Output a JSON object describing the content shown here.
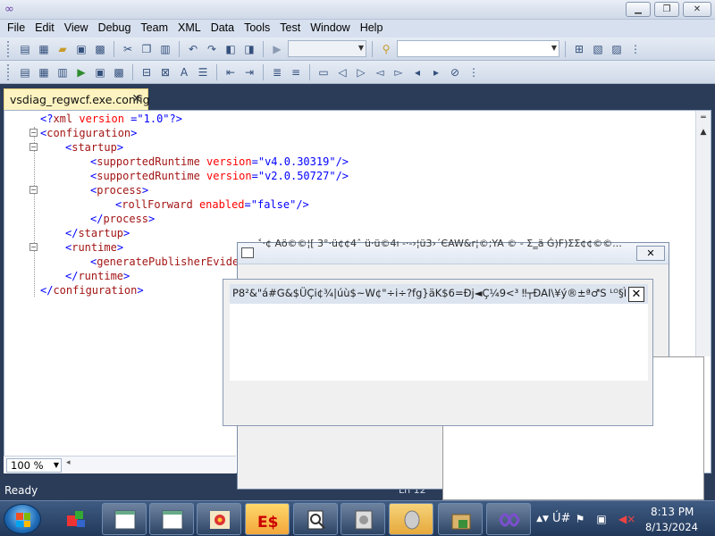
{
  "window": {
    "controls": {
      "minimize": "▁",
      "maximize": "❐",
      "close": "✕"
    }
  },
  "menu": [
    "File",
    "Edit",
    "View",
    "Debug",
    "Team",
    "XML",
    "Data",
    "Tools",
    "Test",
    "Window",
    "Help"
  ],
  "tab": {
    "title": "vsdiag_regwcf.exe.config",
    "close": "✕"
  },
  "code": {
    "lines": [
      {
        "indent": 0,
        "parts": [
          [
            "punct",
            "<?"
          ],
          [
            "tag",
            "xml"
          ],
          [
            "attr",
            " version"
          ],
          [
            "punct",
            " ="
          ],
          [
            "val",
            "\"1.0\""
          ],
          [
            "punct",
            "?>"
          ]
        ]
      },
      {
        "indent": 0,
        "parts": [
          [
            "punct",
            "<"
          ],
          [
            "tag",
            "configuration"
          ],
          [
            "punct",
            ">"
          ]
        ]
      },
      {
        "indent": 1,
        "parts": [
          [
            "punct",
            "<"
          ],
          [
            "tag",
            "startup"
          ],
          [
            "punct",
            ">"
          ]
        ]
      },
      {
        "indent": 2,
        "parts": [
          [
            "punct",
            "<"
          ],
          [
            "tag",
            "supportedRuntime"
          ],
          [
            "attr",
            " version"
          ],
          [
            "punct",
            "="
          ],
          [
            "val",
            "\"v4.0.30319\""
          ],
          [
            "punct",
            "/>"
          ]
        ]
      },
      {
        "indent": 2,
        "parts": [
          [
            "punct",
            "<"
          ],
          [
            "tag",
            "supportedRuntime"
          ],
          [
            "attr",
            " version"
          ],
          [
            "punct",
            "="
          ],
          [
            "val",
            "\"v2.0.50727\""
          ],
          [
            "punct",
            "/>"
          ]
        ]
      },
      {
        "indent": 2,
        "parts": [
          [
            "punct",
            "<"
          ],
          [
            "tag",
            "process"
          ],
          [
            "punct",
            ">"
          ]
        ]
      },
      {
        "indent": 3,
        "parts": [
          [
            "punct",
            "<"
          ],
          [
            "tag",
            "rollForward"
          ],
          [
            "attr",
            " enabled"
          ],
          [
            "punct",
            "="
          ],
          [
            "val",
            "\"false\""
          ],
          [
            "punct",
            "/>"
          ]
        ]
      },
      {
        "indent": 2,
        "parts": [
          [
            "punct",
            "</"
          ],
          [
            "tag",
            "process"
          ],
          [
            "punct",
            ">"
          ]
        ]
      },
      {
        "indent": 1,
        "parts": [
          [
            "punct",
            "</"
          ],
          [
            "tag",
            "startup"
          ],
          [
            "punct",
            ">"
          ]
        ]
      },
      {
        "indent": 1,
        "parts": [
          [
            "punct",
            "<"
          ],
          [
            "tag",
            "runtime"
          ],
          [
            "punct",
            ">"
          ]
        ]
      },
      {
        "indent": 2,
        "parts": [
          [
            "punct",
            "<"
          ],
          [
            "tag",
            "generatePublisherEvider"
          ]
        ]
      },
      {
        "indent": 1,
        "parts": [
          [
            "punct",
            "</"
          ],
          [
            "tag",
            "runtime"
          ],
          [
            "punct",
            ">"
          ]
        ]
      },
      {
        "indent": 0,
        "parts": [
          [
            "punct",
            "</"
          ],
          [
            "tag",
            "configuration"
          ],
          [
            "punct",
            ">"
          ]
        ]
      }
    ]
  },
  "zoom": {
    "value": "100 %"
  },
  "status": {
    "text": "Ready",
    "line": "Ln 12"
  },
  "dialog_back": {
    "title_garble": "˂·¢ Aö©©¦[ 3°·ü¢¢4ˆ ü·ü©4ı ‑·‑›¦ü3›´ЄAW&r¦©;YA ©  ‑ Σ‗ä Ġ)F)ΣΣ¢¢©©..."
  },
  "dialog_front": {
    "notify_text": "P8²&\"á#G&$ÜÇi¢¾|úù$~W¢\"÷i÷?fg}äK$6=Ðj◄Ç¼9<³    ‼┬ÐAI\\¥ý®±ª♂S ᴸᴼ§ÏaŠᴶ Bä...",
    "close": "✕"
  },
  "clock": {
    "time": "8:13 PM",
    "date": "8/13/2024"
  },
  "tray": {
    "lang": "Ú#"
  },
  "icons": {
    "start": "windows-start-icon",
    "taskbar": [
      "app-cube-icon",
      "window-icon",
      "window-icon",
      "flower-app-icon",
      "esp-app-icon",
      "magnifier-doc-icon",
      "media-player-icon",
      "speaker-icon",
      "package-icon",
      "visual-studio-icon"
    ]
  }
}
